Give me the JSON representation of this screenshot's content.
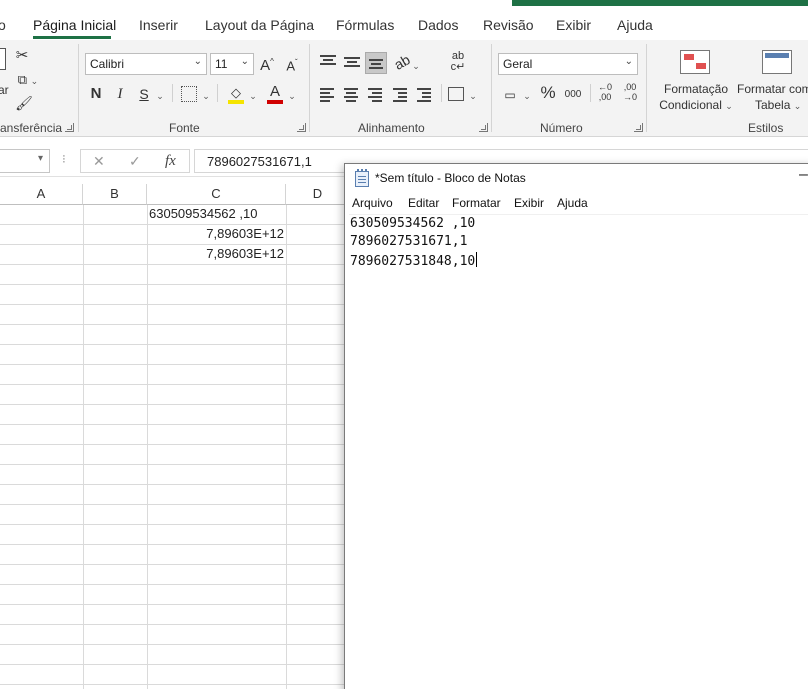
{
  "excel": {
    "ribbon_tabs": [
      {
        "label": "o",
        "active": false
      },
      {
        "label": "Página Inicial",
        "active": true
      },
      {
        "label": "Inserir",
        "active": false
      },
      {
        "label": "Layout da Página",
        "active": false
      },
      {
        "label": "Fórmulas",
        "active": false
      },
      {
        "label": "Dados",
        "active": false
      },
      {
        "label": "Revisão",
        "active": false
      },
      {
        "label": "Exibir",
        "active": false
      },
      {
        "label": "Ajuda",
        "active": false
      }
    ],
    "clipboard": {
      "partial_label": "ar",
      "group_label": "ansferência"
    },
    "font": {
      "font_name": "Calibri",
      "font_size": "11",
      "grow_label": "A",
      "shrink_label": "A",
      "bold_label": "N",
      "italic_label": "I",
      "underline_label": "S",
      "font_color_letter": "A",
      "group_label": "Fonte"
    },
    "alignment": {
      "wrap_label": "ab",
      "group_label": "Alinhamento"
    },
    "number": {
      "format": "Geral",
      "percent_label": "%",
      "thousands_label": "000",
      "increase_decimal_label": "←0 ,00",
      "decrease_decimal_label": ",00 →0",
      "group_label": "Número"
    },
    "styles": {
      "conditional_line1": "Formatação",
      "conditional_line2": "Condicional",
      "table_line1": "Formatar com",
      "table_line2": "Tabela",
      "group_label": "Estilos"
    },
    "formula_bar": {
      "name_box": "",
      "fx_label": "fx",
      "value": "7896027531671,1"
    },
    "columns": [
      "A",
      "B",
      "C",
      "D"
    ],
    "cells": {
      "C1": "630509534562 ,10",
      "C2": "7,89603E+12",
      "C3": "7,89603E+12"
    },
    "colors": {
      "accent": "#1e7145",
      "ribbon_bg": "#f3f3f3",
      "gridline": "#dadada"
    }
  },
  "notepad": {
    "title": "*Sem título - Bloco de Notas",
    "minimize_label": "–",
    "menu": [
      "Arquivo",
      "Editar",
      "Formatar",
      "Exibir",
      "Ajuda"
    ],
    "lines": [
      "630509534562 ,10",
      "7896027531671,1",
      "7896027531848,10"
    ]
  }
}
